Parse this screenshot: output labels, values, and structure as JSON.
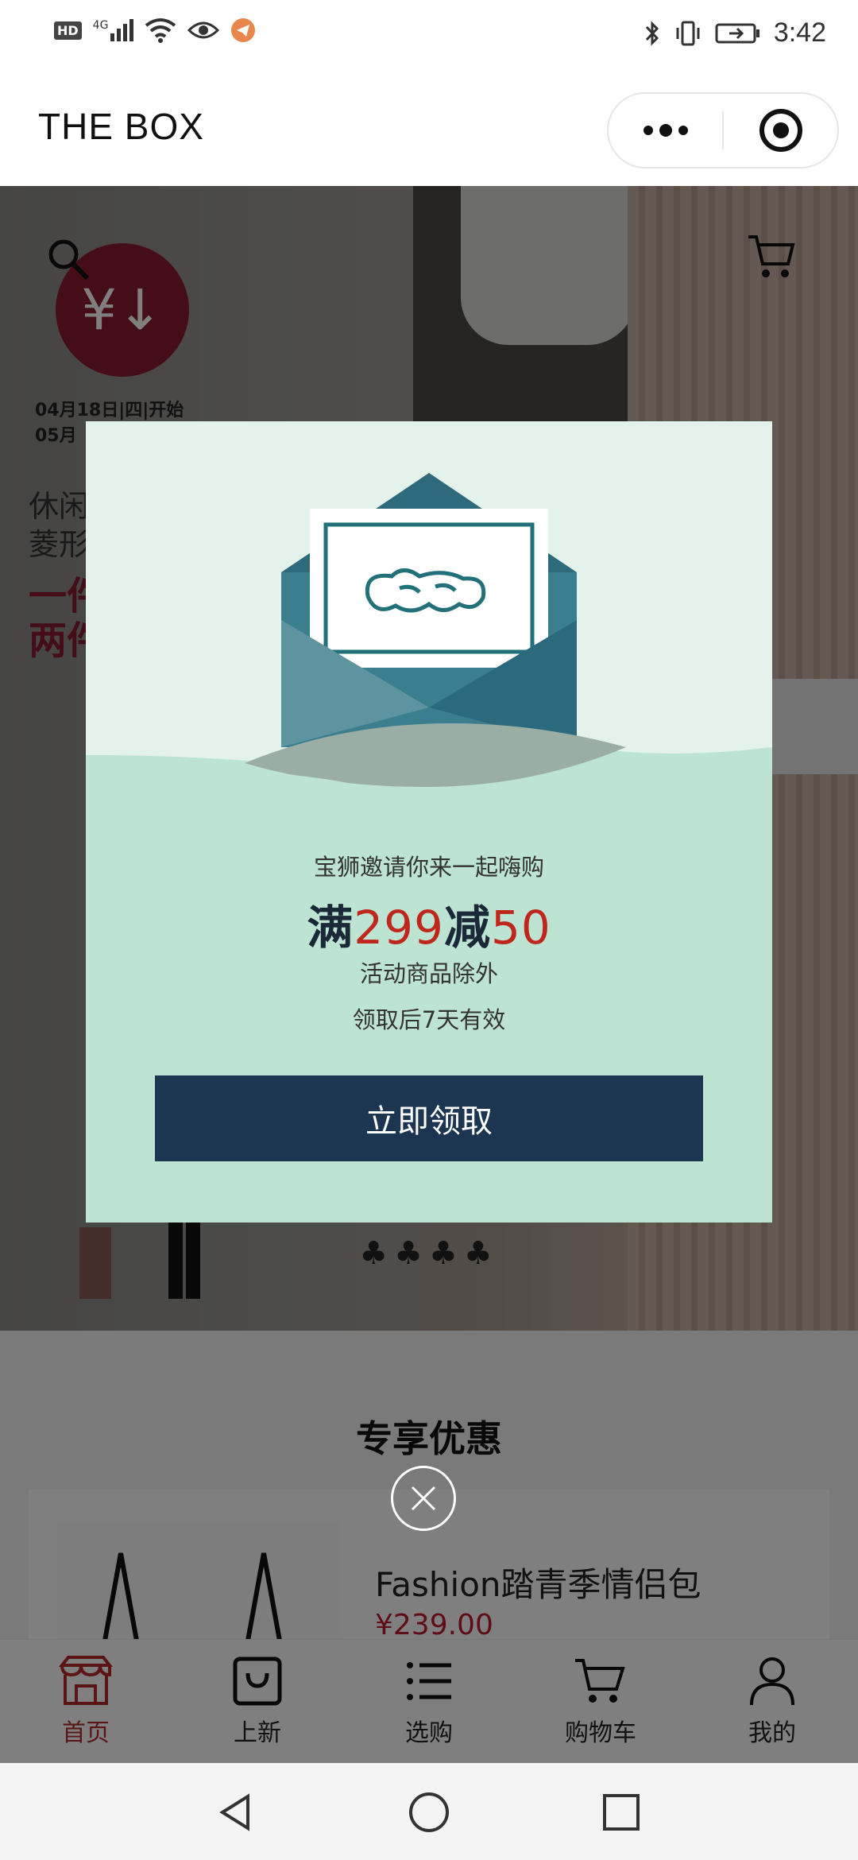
{
  "status_bar": {
    "left_icons": [
      "hd-icon",
      "4g-signal-icon",
      "wifi-icon",
      "eye-icon",
      "telegram-icon"
    ],
    "hd": "HD",
    "network": "4G",
    "time": "3:42"
  },
  "header": {
    "title": "THE BOX"
  },
  "hero": {
    "promo_symbol": "¥↓",
    "date_line1": "04月18日|四|开始",
    "date_line2": "05月",
    "text1": "休闲",
    "text2": "菱形",
    "text3": "一件",
    "text4": "两件",
    "dots": "♣♣♣♣"
  },
  "modal": {
    "invite": "宝狮邀请你来一起嗨购",
    "offer_prefix": "满",
    "offer_amount": "299",
    "offer_mid": "减",
    "offer_discount": "50",
    "note1": "活动商品除外",
    "note2": "领取后7天有效",
    "claim_label": "立即领取",
    "colors": {
      "button": "#1c3550",
      "bg": "#bde3d3",
      "accent": "#c0271c"
    }
  },
  "section": {
    "title": "专享优惠",
    "card_name": "Fashion踏青季情侣包",
    "card_price": "¥239.00"
  },
  "tabbar": {
    "items": [
      {
        "label": "首页",
        "icon": "shop-icon",
        "active": true
      },
      {
        "label": "上新",
        "icon": "bag-icon",
        "active": false
      },
      {
        "label": "选购",
        "icon": "list-icon",
        "active": false
      },
      {
        "label": "购物车",
        "icon": "cart-icon",
        "active": false
      },
      {
        "label": "我的",
        "icon": "user-icon",
        "active": false
      }
    ]
  }
}
